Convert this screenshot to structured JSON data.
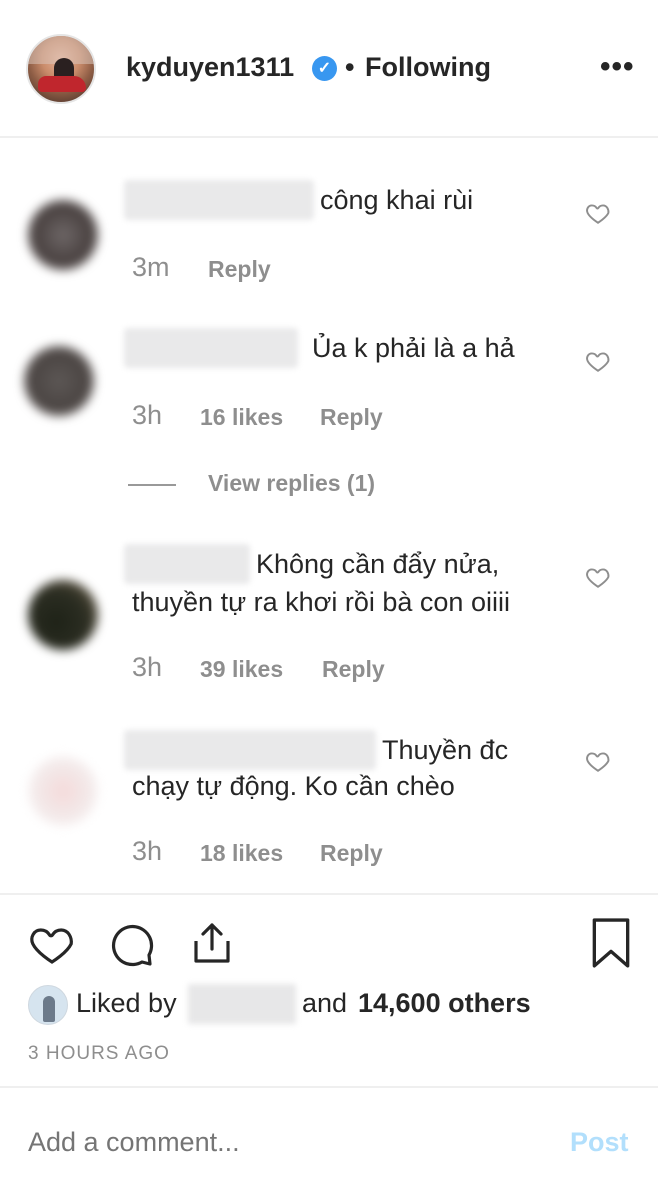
{
  "header": {
    "username": "kyduyen1311",
    "separator": "•",
    "follow_state": "Following",
    "more_label": "•••"
  },
  "comments": [
    {
      "text_line1": "công khai rùi",
      "text_line2": "",
      "time": "3m",
      "likes": "",
      "reply_label": "Reply"
    },
    {
      "text_line1": "Ủa k phải là a hả",
      "text_line2": "",
      "time": "3h",
      "likes": "16 likes",
      "reply_label": "Reply"
    },
    {
      "text_line1": "Không cần đẩy nửa,",
      "text_line2": "thuyền tự ra khơi rồi bà con oiiii",
      "time": "3h",
      "likes": "39 likes",
      "reply_label": "Reply"
    },
    {
      "text_line1": "Thuyền đc",
      "text_line2": "chạy tự động. Ko cần chèo",
      "time": "3h",
      "likes": "18 likes",
      "reply_label": "Reply"
    }
  ],
  "view_replies": "View replies (1)",
  "likes_summary": {
    "prefix": "Liked by",
    "and": "and",
    "count_text": "14,600 others"
  },
  "posted_ago": "3 HOURS AGO",
  "comment_box": {
    "placeholder": "Add a comment...",
    "post_label": "Post"
  },
  "colors": {
    "text": "#262626",
    "secondary": "#8e8e8e",
    "verified": "#3897f0",
    "post_disabled": "#b2dffc"
  }
}
